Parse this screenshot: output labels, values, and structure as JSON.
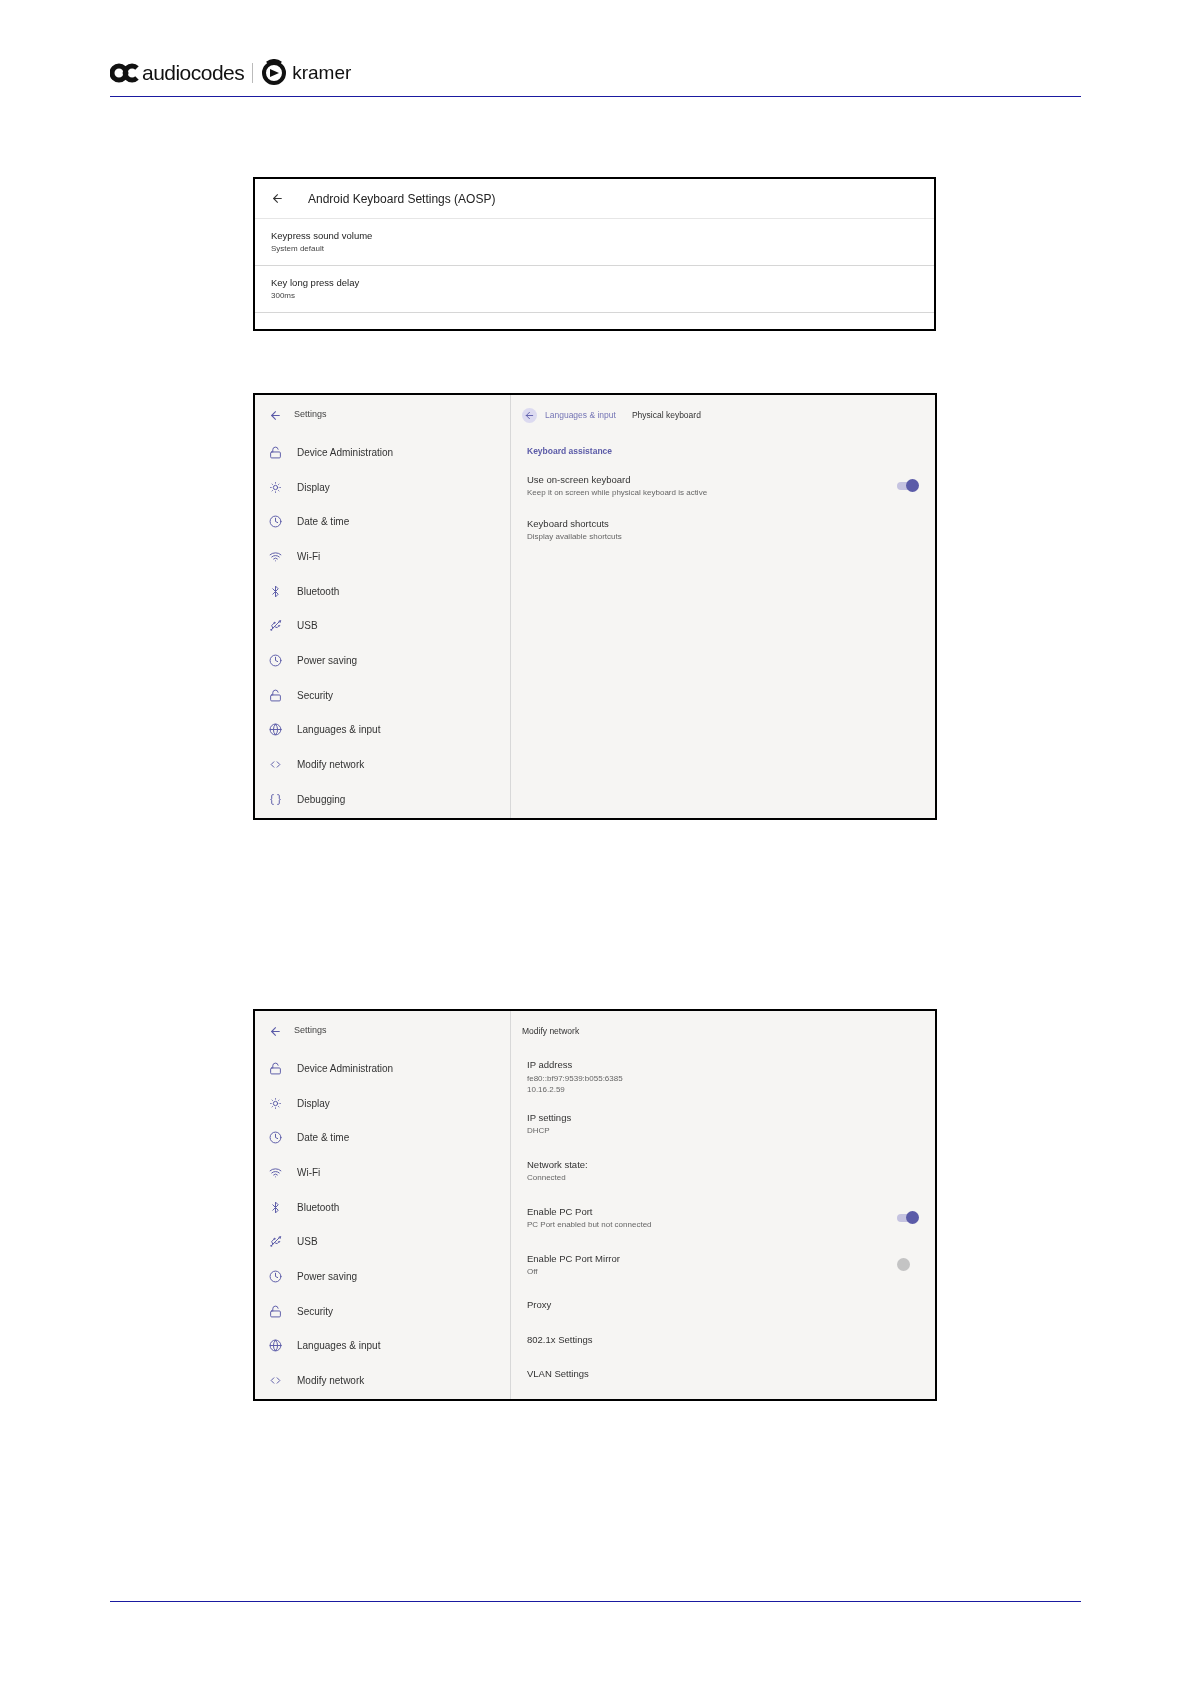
{
  "header": {
    "brand_1": "audiocodes",
    "brand_2": "kramer"
  },
  "keyboard_settings": {
    "title": "Android Keyboard Settings (AOSP)",
    "items": [
      {
        "title": "Keypress sound volume",
        "summary": "System default"
      },
      {
        "title": "Key long press delay",
        "summary": "300ms"
      }
    ]
  },
  "physical_keyboard_screen": {
    "sidebar": {
      "title": "Settings",
      "items": [
        {
          "kind": "lock",
          "label": "Device Administration",
          "selected": false
        },
        {
          "kind": "brightness",
          "label": "Display",
          "selected": false
        },
        {
          "kind": "clock",
          "label": "Date & time",
          "selected": false
        },
        {
          "kind": "wifi",
          "label": "Wi-Fi",
          "selected": false
        },
        {
          "kind": "bluetooth",
          "label": "Bluetooth",
          "selected": false
        },
        {
          "kind": "usb",
          "label": "USB",
          "selected": false
        },
        {
          "kind": "clock",
          "label": "Power saving",
          "selected": false
        },
        {
          "kind": "lock",
          "label": "Security",
          "selected": false
        },
        {
          "kind": "globe",
          "label": "Languages & input",
          "selected": false
        },
        {
          "kind": "network",
          "label": "Modify network",
          "selected": false
        },
        {
          "kind": "braces",
          "label": "Debugging",
          "selected": false
        }
      ]
    },
    "breadcrumb_parent": "Languages & input",
    "title": "Physical keyboard",
    "section": "Keyboard assistance",
    "items": [
      {
        "kind": "switch",
        "title": "Use on-screen keyboard",
        "summary": "Keep it on screen while physical keyboard is active",
        "on": true
      },
      {
        "kind": "plain",
        "title": "Keyboard shortcuts",
        "summary": "Display available shortcuts"
      }
    ]
  },
  "modify_network_screen": {
    "sidebar": {
      "title": "Settings",
      "items": [
        {
          "kind": "lock",
          "label": "Device Administration",
          "selected": false
        },
        {
          "kind": "brightness",
          "label": "Display",
          "selected": false
        },
        {
          "kind": "clock",
          "label": "Date & time",
          "selected": false
        },
        {
          "kind": "wifi",
          "label": "Wi-Fi",
          "selected": false
        },
        {
          "kind": "bluetooth",
          "label": "Bluetooth",
          "selected": false
        },
        {
          "kind": "usb",
          "label": "USB",
          "selected": false
        },
        {
          "kind": "clock",
          "label": "Power saving",
          "selected": false
        },
        {
          "kind": "lock",
          "label": "Security",
          "selected": false
        },
        {
          "kind": "globe",
          "label": "Languages & input",
          "selected": false
        },
        {
          "kind": "network",
          "label": "Modify network",
          "selected": false
        }
      ]
    },
    "title": "Modify network",
    "items": [
      {
        "kind": "plain",
        "title": "IP address",
        "summary_lines": [
          "fe80::bf97:9539:b055:6385",
          "10.16.2.59"
        ]
      },
      {
        "kind": "plain",
        "title": "IP settings",
        "summary_lines": [
          "DHCP"
        ]
      },
      {
        "kind": "plain",
        "title": "Network state:",
        "summary_lines": [
          "Connected"
        ]
      },
      {
        "kind": "switch",
        "title": "Enable PC Port",
        "summary_lines": [
          "PC Port enabled but not connected"
        ],
        "on": true
      },
      {
        "kind": "switch",
        "title": "Enable PC Port Mirror",
        "summary_lines": [
          "Off"
        ],
        "on": false
      },
      {
        "kind": "plain",
        "title": "Proxy"
      },
      {
        "kind": "plain",
        "title": "802.1x Settings"
      },
      {
        "kind": "plain",
        "title": "VLAN Settings"
      }
    ]
  }
}
